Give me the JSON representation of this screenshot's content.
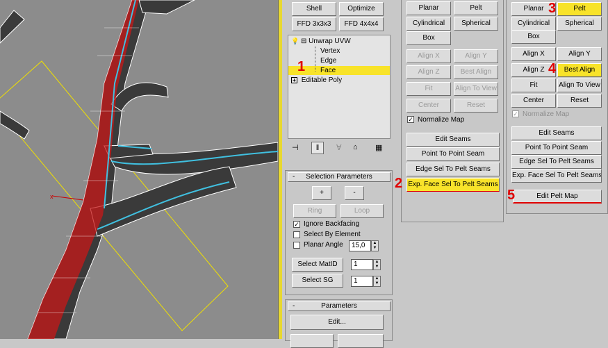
{
  "modifier_panel": {
    "top_buttons": [
      "Shell",
      "Optimize",
      "FFD 3x3x3",
      "FFD 4x4x4"
    ],
    "stack": {
      "items": [
        {
          "label": "Unwrap UVW",
          "expander": "⊟"
        },
        {
          "label": "Vertex"
        },
        {
          "label": "Edge"
        },
        {
          "label": "Face",
          "selected": true
        },
        {
          "label": "Editable Poly",
          "expander": "⊞"
        }
      ]
    },
    "toolbar_icons": [
      "pin-stack-icon",
      "show-end-result-icon",
      "make-unique-icon",
      "remove-modifier-icon",
      "configure-modifier-sets-icon"
    ],
    "selection_parameters": {
      "title": "Selection Parameters",
      "plus": "+",
      "minus": "-",
      "ring": "Ring",
      "loop": "Loop",
      "ignore_backfacing": "Ignore Backfacing",
      "select_by_element": "Select By Element",
      "planar_angle": "Planar Angle",
      "planar_angle_value": "15,0",
      "select_matid": "Select MatID",
      "matid_value": "1",
      "select_sg": "Select SG",
      "sg_value": "1"
    },
    "parameters": {
      "title": "Parameters",
      "edit": "Edit..."
    }
  },
  "map_panel_1": {
    "planar": "Planar",
    "pelt": "Pelt",
    "cylindrical": "Cylindrical",
    "spherical": "Spherical",
    "box": "Box",
    "align_x": "Align X",
    "align_y": "Align Y",
    "align_z": "Align Z",
    "best_align": "Best Align",
    "fit": "Fit",
    "align_to_view": "Align To View",
    "center": "Center",
    "reset": "Reset",
    "normalize_map": "Normalize Map",
    "edit_seams": "Edit Seams",
    "point_to_point_seam": "Point To Point Seam",
    "edge_sel_to_pelt": "Edge Sel To Pelt Seams",
    "exp_face_sel_to_pelt": "Exp. Face Sel To Pelt Seams"
  },
  "map_panel_2": {
    "planar": "Planar",
    "pelt": "Pelt",
    "cylindrical": "Cylindrical",
    "spherical": "Spherical",
    "box": "Box",
    "align_x": "Align X",
    "align_y": "Align Y",
    "align_z": "Align Z",
    "best_align": "Best Align",
    "fit": "Fit",
    "align_to_view": "Align To View",
    "center": "Center",
    "reset": "Reset",
    "normalize_map": "Normalize Map",
    "edit_seams": "Edit Seams",
    "point_to_point_seam": "Point To Point Seam",
    "edge_sel_to_pelt": "Edge Sel To Pelt Seams",
    "exp_face_sel_to_pelt": "Exp. Face Sel To Pelt Seams",
    "edit_pelt_map": "Edit Pelt Map"
  },
  "step_markers": [
    "1",
    "2",
    "3",
    "4",
    "5"
  ],
  "colors": {
    "highlight": "#f8e32a",
    "marker": "#e00000",
    "viewport": "#8c8c8c"
  }
}
